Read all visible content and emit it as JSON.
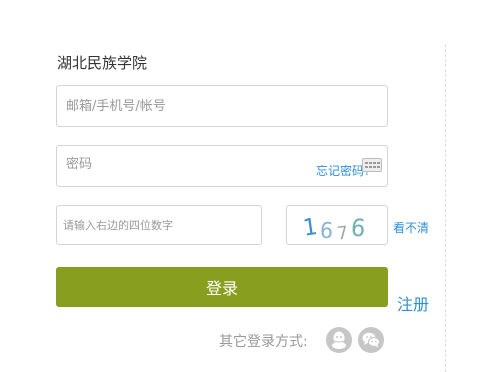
{
  "org": {
    "title": "湖北民族学院"
  },
  "form": {
    "account_placeholder": "邮箱/手机号/帐号",
    "password_placeholder": "密码",
    "forgot_password": "忘记密码?",
    "captcha_placeholder": "请输入右边的四位数字",
    "captcha_text": "1676",
    "refresh_captcha": "看不清",
    "login_button": "登录",
    "register_link": "注册"
  },
  "other_login": {
    "label": "其它登录方式:",
    "methods": [
      {
        "name": "qq",
        "icon": "qq-icon"
      },
      {
        "name": "wechat",
        "icon": "wechat-icon"
      }
    ]
  },
  "icons": {
    "keyboard": "keyboard-icon"
  },
  "colors": {
    "accent_green": "#889e1e",
    "link_blue": "#2f8fd8",
    "muted_gray": "#999999",
    "border_gray": "#d4d4d4",
    "captcha_digits": [
      "#3a8fd0",
      "#8bb3d6",
      "#9aa6ad",
      "#6fb1b4"
    ]
  }
}
